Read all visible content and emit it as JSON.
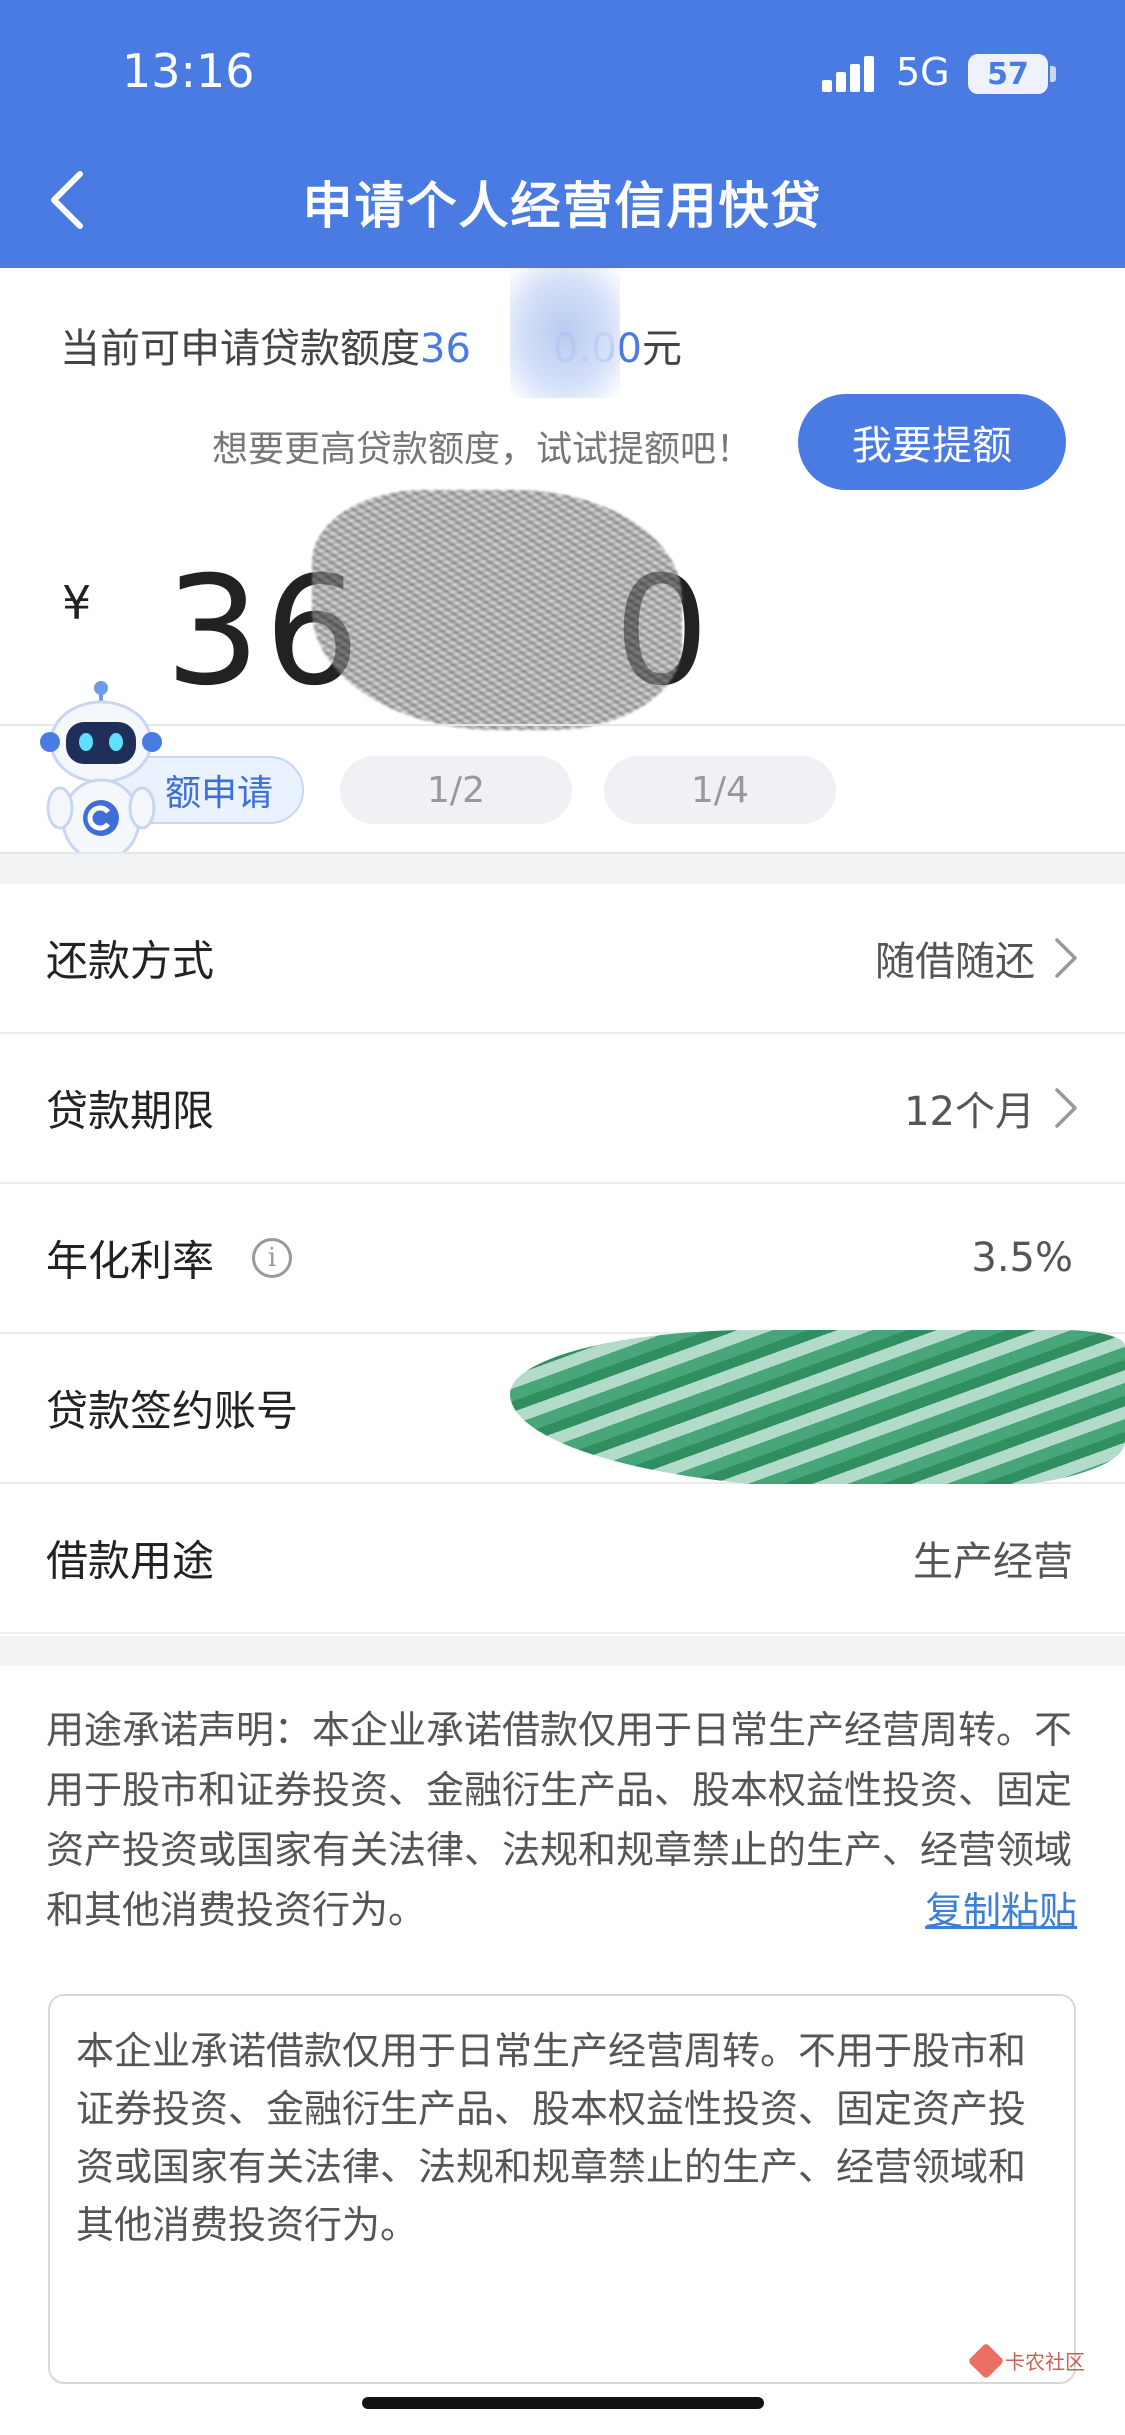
{
  "status_bar": {
    "time": "13:16",
    "network": "5G",
    "battery": "57"
  },
  "header": {
    "title": "申请个人经营信用快贷"
  },
  "quota": {
    "label": "当前可申请贷款额度",
    "amount_prefix": "36",
    "amount_suffix": "0.00",
    "unit": "元",
    "hint": "想要更高贷款额度，试试提额吧！",
    "raise_button": "我要提额"
  },
  "amount": {
    "currency": "¥",
    "left": "36",
    "right": "0"
  },
  "chips": {
    "full": "额申请",
    "half": "1/2",
    "quarter": "1/4"
  },
  "form": {
    "repayment": {
      "label": "还款方式",
      "value": "随借随还"
    },
    "term": {
      "label": "贷款期限",
      "value": "12个月"
    },
    "rate": {
      "label": "年化利率",
      "value": "3.5%"
    },
    "account": {
      "label": "贷款签约账号"
    },
    "purpose": {
      "label": "借款用途",
      "value": "生产经营"
    }
  },
  "declaration": {
    "text": "用途承诺声明：本企业承诺借款仅用于日常生产经营周转。不用于股市和证券投资、金融衍生产品、股本权益性投资、固定资产投资或国家有关法律、法规和规章禁止的生产、经营领域和其他消费投资行为。",
    "copy_link": "复制粘贴",
    "textbox": "本企业承诺借款仅用于日常生产经营周转。不用于股市和证券投资、金融衍生产品、股本权益性投资、固定资产投资或国家有关法律、法规和规章禁止的生产、经营领域和其他消费投资行为。"
  },
  "watermark": {
    "text": "卡农社区"
  },
  "colors": {
    "primary": "#4a7be3",
    "link": "#3e7fd6"
  }
}
